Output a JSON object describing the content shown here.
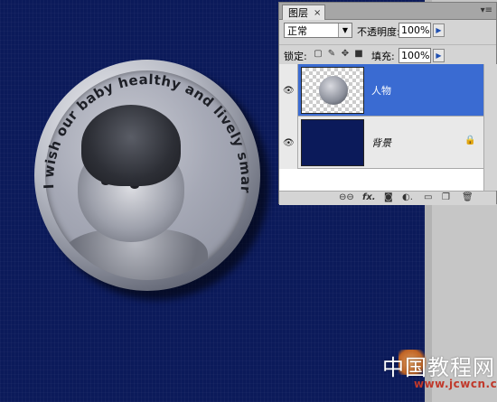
{
  "canvas": {
    "background_color": "#0b1a5a"
  },
  "coin": {
    "inscription": "I wish our baby healthy and lively smart growth"
  },
  "layers_panel": {
    "tab_label": "图层",
    "tab_close": "×",
    "menu_icon": "panel-menu-icon",
    "blend_mode": "正常",
    "opacity_label": "不透明度:",
    "opacity_value": "100%",
    "lock_label": "锁定:",
    "fill_label": "填充:",
    "fill_value": "100%",
    "layers": [
      {
        "name": "人物",
        "selected": true
      },
      {
        "name": "背景",
        "selected": false,
        "locked": true
      }
    ],
    "selection_color": "#3a6bd2"
  },
  "watermark": {
    "title": "中国教程网",
    "url": "www.jcwcn.com"
  }
}
